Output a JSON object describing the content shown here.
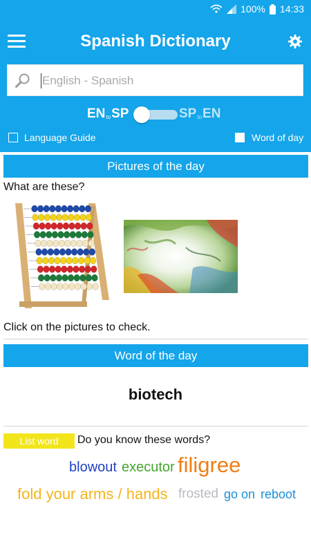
{
  "status": {
    "battery": "100%",
    "time": "14:33"
  },
  "app": {
    "title": "Spanish Dictionary",
    "search_placeholder": "English - Spanish",
    "toggle_left_main1": "EN",
    "toggle_left_to": "to",
    "toggle_left_main2": "SP",
    "toggle_right_main1": "SP",
    "toggle_right_to": "to",
    "toggle_right_main2": "EN",
    "language_guide_label": "Language Guide",
    "word_of_day_checkbox_label": "Word of day"
  },
  "pictures": {
    "header": "Pictures of the day",
    "question": "What are these?",
    "hint": "Click on the pictures to check."
  },
  "word_of_day": {
    "header": "Word of the day",
    "word": "biotech"
  },
  "word_list": {
    "button": "List word",
    "prompt": "Do you know these words?",
    "words": [
      {
        "text": "blowout",
        "color": "#1f3fc4"
      },
      {
        "text": "executor",
        "color": "#43a52e"
      },
      {
        "text": "filigree",
        "color": "#f07d14"
      },
      {
        "text": "fold your arms / hands",
        "color": "#f4b41e"
      },
      {
        "text": "frosted",
        "color": "#b9b9c4"
      },
      {
        "text": "go on",
        "color": "#1b8fd8"
      },
      {
        "text": "reboot",
        "color": "#1b8fd8"
      }
    ]
  }
}
